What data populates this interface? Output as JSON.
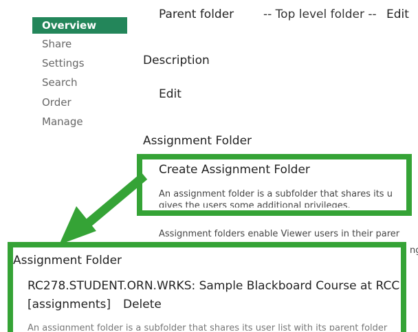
{
  "sidebar": {
    "items": [
      {
        "label": "Overview",
        "active": true
      },
      {
        "label": "Share"
      },
      {
        "label": "Settings"
      },
      {
        "label": "Search"
      },
      {
        "label": "Order"
      },
      {
        "label": "Manage"
      }
    ]
  },
  "parent_folder": {
    "label": "Parent folder",
    "value": "-- Top level folder --",
    "edit": "Edit"
  },
  "description": {
    "heading": "Description",
    "edit": "Edit"
  },
  "assignment_section": {
    "heading": "Assignment Folder",
    "create_link": "Create Assignment Folder",
    "desc_line1": "An assignment folder is a subfolder that shares its u",
    "desc_line2": "gives the users some additional privileges.",
    "enable_line1": "Assignment folders enable Viewer users in their parer",
    "enable_line2": "ng"
  },
  "callout": {
    "heading": "Assignment Folder",
    "course_link": "RC278.STUDENT.ORN.WRKS: Sample Blackboard Course at RCC",
    "assignments_link": "[assignments]",
    "delete_link": "Delete",
    "footer_text": "An assignment folder is a subfolder that shares its user list with its parent folder"
  },
  "colors": {
    "accent_green": "#35a336",
    "nav_active_bg": "#23865a",
    "link_blue": "#2b8ccf"
  }
}
